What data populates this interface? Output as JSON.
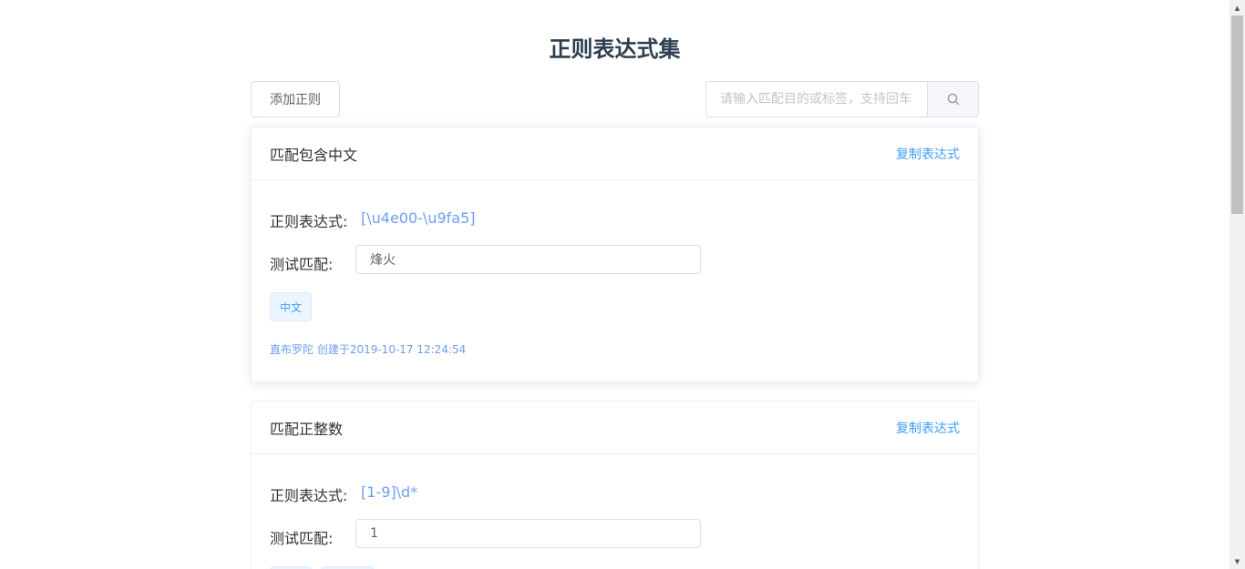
{
  "title": "正则表达式集",
  "toolbar": {
    "add_label": "添加正则",
    "search_placeholder": "请输入匹配目的或标签，支持回车"
  },
  "cards": [
    {
      "title": "匹配包含中文",
      "copy_label": "复制表达式",
      "regex_label": "正则表达式:",
      "regex": "[\\u4e00-\\u9fa5]",
      "test_label": "测试匹配:",
      "test_value": "烽火",
      "tags": [
        "中文"
      ],
      "meta": "直布罗陀 创建于2019-10-17 12:24:54"
    },
    {
      "title": "匹配正整数",
      "copy_label": "复制表达式",
      "regex_label": "正则表达式:",
      "regex": "[1-9]\\d*",
      "test_label": "测试匹配:",
      "test_value": "1"
    }
  ],
  "icons": {
    "search": "search-icon",
    "scroll_up": "scroll-up-arrow",
    "scroll_down": "scroll-down-arrow"
  },
  "colors": {
    "primary": "#409eff",
    "regex_text": "#6e9ef5",
    "title_text": "#2c3e50",
    "border": "#dcdfe6"
  }
}
